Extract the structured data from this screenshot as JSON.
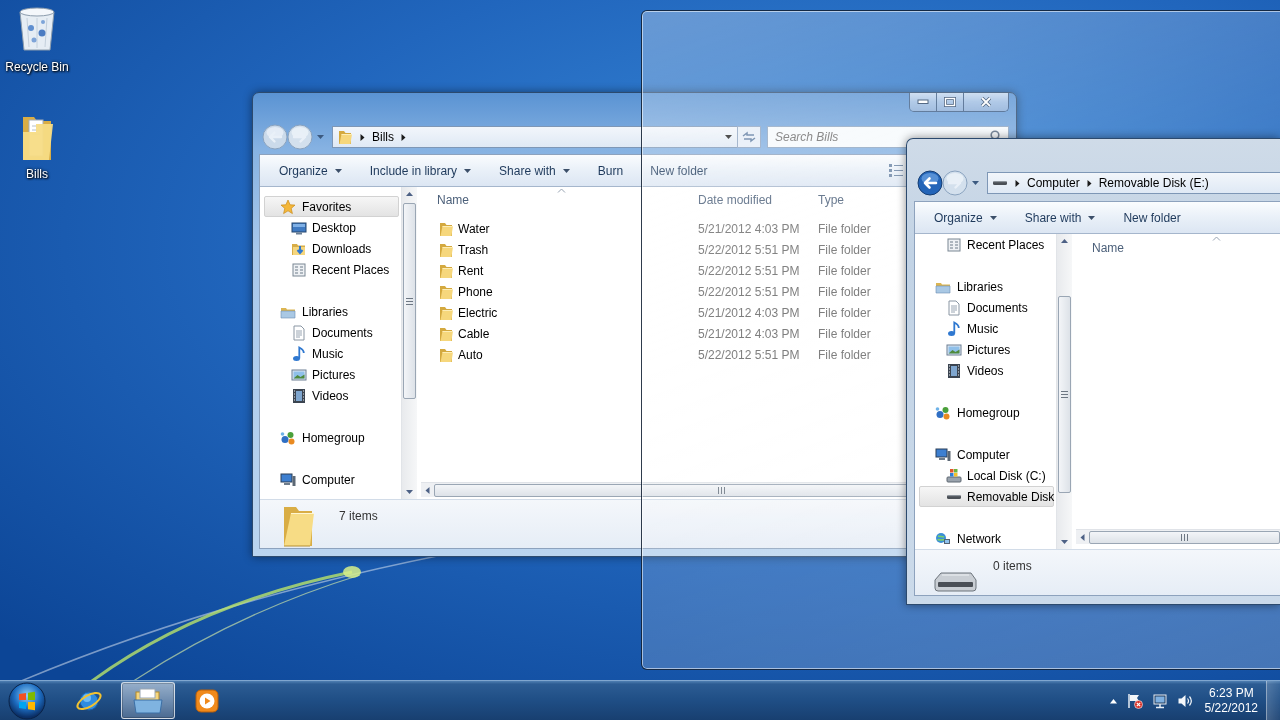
{
  "desktop_icons": [
    {
      "label": "Recycle Bin",
      "kind": "recycle-bin"
    },
    {
      "label": "Bills",
      "kind": "folder"
    }
  ],
  "windows": [
    {
      "back_enabled": false,
      "address": {
        "kind": "folder",
        "crumbs": [
          "Bills"
        ],
        "trailing_arrow": true
      },
      "search": {
        "placeholder": "Search Bills"
      },
      "commands": [
        {
          "label": "Organize",
          "menu": true
        },
        {
          "label": "Include in library",
          "menu": true
        },
        {
          "label": "Share with",
          "menu": true
        },
        {
          "label": "Burn",
          "menu": false
        },
        {
          "label": "New folder",
          "menu": false
        }
      ],
      "nav_pane": {
        "groups": [
          {
            "label": "Favorites",
            "kind": "favorites",
            "selected": true,
            "children": [
              {
                "label": "Desktop",
                "kind": "desktop",
                "selected": false
              },
              {
                "label": "Downloads",
                "kind": "downloads",
                "selected": false
              },
              {
                "label": "Recent Places",
                "kind": "recent",
                "selected": false
              }
            ]
          },
          {
            "label": "Libraries",
            "kind": "libraries",
            "selected": false,
            "children": [
              {
                "label": "Documents",
                "kind": "documents",
                "selected": false
              },
              {
                "label": "Music",
                "kind": "music",
                "selected": false
              },
              {
                "label": "Pictures",
                "kind": "pictures",
                "selected": false
              },
              {
                "label": "Videos",
                "kind": "videos",
                "selected": false
              }
            ]
          },
          {
            "label": "Homegroup",
            "kind": "homegroup",
            "selected": false
          },
          {
            "label": "Computer",
            "kind": "computer",
            "selected": false
          }
        ]
      },
      "columns": [
        {
          "label": "Name",
          "sorted": true
        },
        {
          "label": "Date modified",
          "sorted": false
        },
        {
          "label": "Type",
          "sorted": false
        }
      ],
      "rows": [
        {
          "name": "Water",
          "date_modified": "5/21/2012 4:03 PM",
          "type": "File folder"
        },
        {
          "name": "Trash",
          "date_modified": "5/22/2012 5:51 PM",
          "type": "File folder"
        },
        {
          "name": "Rent",
          "date_modified": "5/22/2012 5:51 PM",
          "type": "File folder"
        },
        {
          "name": "Phone",
          "date_modified": "5/22/2012 5:51 PM",
          "type": "File folder"
        },
        {
          "name": "Electric",
          "date_modified": "5/21/2012 4:03 PM",
          "type": "File folder"
        },
        {
          "name": "Cable",
          "date_modified": "5/21/2012 4:03 PM",
          "type": "File folder"
        },
        {
          "name": "Auto",
          "date_modified": "5/22/2012 5:51 PM",
          "type": "File folder"
        }
      ],
      "details": {
        "kind": "folder",
        "text": "7 items"
      }
    },
    {
      "back_enabled": true,
      "address": {
        "kind": "drive",
        "crumbs": [
          "Computer",
          "Removable Disk (E:)"
        ],
        "trailing_arrow": false
      },
      "commands": [
        {
          "label": "Organize",
          "menu": true
        },
        {
          "label": "Share with",
          "menu": true
        },
        {
          "label": "New folder",
          "menu": false
        }
      ],
      "nav_pane": {
        "groups": [
          {
            "children": [
              {
                "label": "Recent Places",
                "kind": "recent",
                "selected": false
              }
            ]
          },
          {
            "label": "Libraries",
            "kind": "libraries",
            "selected": false,
            "children": [
              {
                "label": "Documents",
                "kind": "documents",
                "selected": false
              },
              {
                "label": "Music",
                "kind": "music",
                "selected": false
              },
              {
                "label": "Pictures",
                "kind": "pictures",
                "selected": false
              },
              {
                "label": "Videos",
                "kind": "videos",
                "selected": false
              }
            ]
          },
          {
            "label": "Homegroup",
            "kind": "homegroup",
            "selected": false
          },
          {
            "label": "Computer",
            "kind": "computer",
            "selected": false,
            "children": [
              {
                "label": "Local Disk (C:)",
                "kind": "local-disk",
                "selected": false
              },
              {
                "label": "Removable Disk",
                "kind": "removable-disk",
                "selected": true
              }
            ]
          },
          {
            "label": "Network",
            "kind": "network",
            "selected": false
          }
        ]
      },
      "columns": [
        {
          "label": "Name",
          "sorted": true
        }
      ],
      "details": {
        "kind": "drive",
        "text": "0 items"
      }
    }
  ],
  "taskbar": {
    "buttons": [
      {
        "kind": "browser",
        "selected": false
      },
      {
        "kind": "file-manager",
        "selected": true
      },
      {
        "kind": "media-player",
        "selected": false
      }
    ],
    "clock": {
      "time": "6:23 PM",
      "date": "5/22/2012"
    }
  }
}
